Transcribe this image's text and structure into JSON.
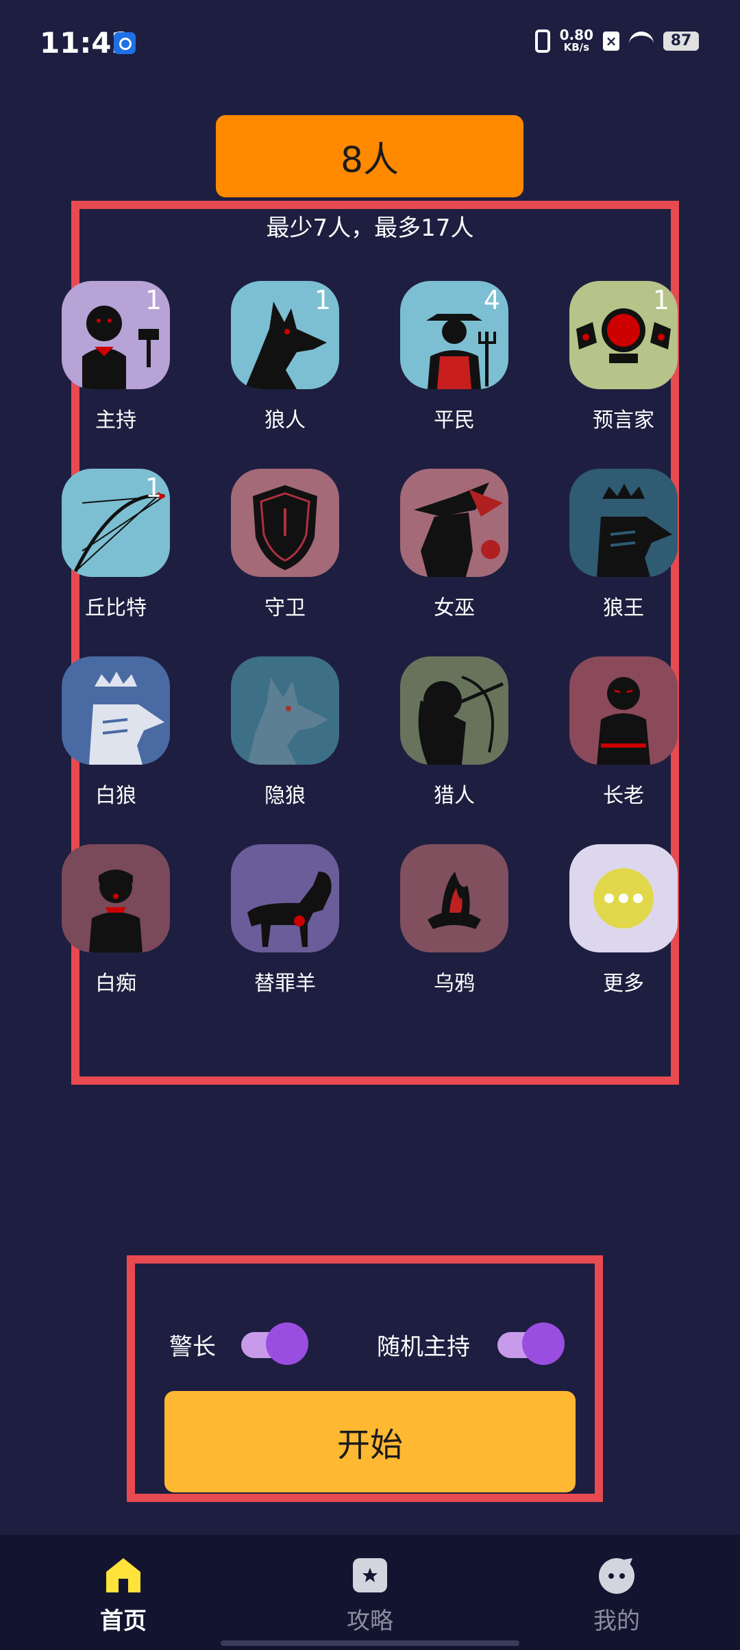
{
  "status_bar": {
    "time": "11:42",
    "net_speed": "0.80",
    "net_unit": "KB/s",
    "sim": "×",
    "battery": "87"
  },
  "players": {
    "count_label": "8人",
    "limits": "最少7人，最多17人"
  },
  "roles": [
    {
      "label": "主持",
      "count": "1",
      "icon": "host-icon",
      "bg": "#b7a3d6"
    },
    {
      "label": "狼人",
      "count": "1",
      "icon": "werewolf-icon",
      "bg": "#7cbfd2"
    },
    {
      "label": "平民",
      "count": "4",
      "icon": "villager-icon",
      "bg": "#7cbfd2"
    },
    {
      "label": "预言家",
      "count": "1",
      "icon": "seer-icon",
      "bg": "#b6c489"
    },
    {
      "label": "丘比特",
      "count": "1",
      "icon": "cupid-icon",
      "bg": "#7cbfd2"
    },
    {
      "label": "守卫",
      "count": "",
      "icon": "guard-icon",
      "bg": "#a46a78"
    },
    {
      "label": "女巫",
      "count": "",
      "icon": "witch-icon",
      "bg": "#a46a78"
    },
    {
      "label": "狼王",
      "count": "",
      "icon": "wolf-king-icon",
      "bg": "#2f5b73"
    },
    {
      "label": "白狼",
      "count": "",
      "icon": "white-wolf-icon",
      "bg": "#4a6aa3"
    },
    {
      "label": "隐狼",
      "count": "",
      "icon": "hidden-wolf-icon",
      "bg": "#3d6f86"
    },
    {
      "label": "猎人",
      "count": "",
      "icon": "hunter-icon",
      "bg": "#68735c"
    },
    {
      "label": "长老",
      "count": "",
      "icon": "elder-icon",
      "bg": "#8a4a5a"
    },
    {
      "label": "白痴",
      "count": "",
      "icon": "idiot-icon",
      "bg": "#7a4a5a"
    },
    {
      "label": "替罪羊",
      "count": "",
      "icon": "scapegoat-icon",
      "bg": "#6b5c9a"
    },
    {
      "label": "乌鸦",
      "count": "",
      "icon": "crow-icon",
      "bg": "#80505e"
    },
    {
      "label": "更多",
      "count": "",
      "icon": "more-icon",
      "bg": "#ddd7ee"
    }
  ],
  "options": {
    "sheriff_label": "警长",
    "random_host_label": "随机主持",
    "sheriff_on": true,
    "random_host_on": true
  },
  "start_label": "开始",
  "nav": [
    {
      "label": "首页",
      "icon": "home-icon",
      "active": true
    },
    {
      "label": "攻略",
      "icon": "guide-icon",
      "active": false
    },
    {
      "label": "我的",
      "icon": "profile-icon",
      "active": false
    }
  ],
  "colors": {
    "background": "#1e1e40",
    "highlight": "#e84a52",
    "count_button": "#ff8a00",
    "start_button": "#ffb832",
    "toggle": "#9a4ee0",
    "nav_active": "#ffe33a"
  }
}
